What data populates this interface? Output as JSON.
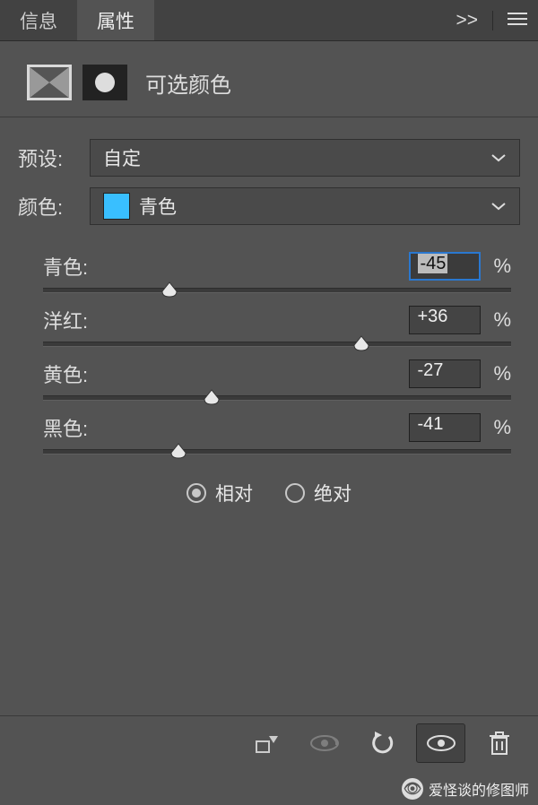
{
  "tabs": {
    "info": "信息",
    "properties": "属性",
    "active": "properties"
  },
  "panel": {
    "title": "可选颜色"
  },
  "preset": {
    "label": "预设:",
    "value": "自定"
  },
  "colors": {
    "label": "颜色:",
    "value": "青色",
    "swatch": "#39bfff"
  },
  "sliders": [
    {
      "key": "cyan",
      "label": "青色:",
      "value": "-45",
      "unit": "%",
      "pos": 27,
      "focused": true
    },
    {
      "key": "magenta",
      "label": "洋红:",
      "value": "+36",
      "unit": "%",
      "pos": 68,
      "focused": false
    },
    {
      "key": "yellow",
      "label": "黄色:",
      "value": "-27",
      "unit": "%",
      "pos": 36,
      "focused": false
    },
    {
      "key": "black",
      "label": "黑色:",
      "value": "-41",
      "unit": "%",
      "pos": 29,
      "focused": false
    }
  ],
  "method": {
    "relative": "相对",
    "absolute": "绝对",
    "selected": "relative"
  },
  "watermark": {
    "text": "爱怪谈的修图师"
  }
}
